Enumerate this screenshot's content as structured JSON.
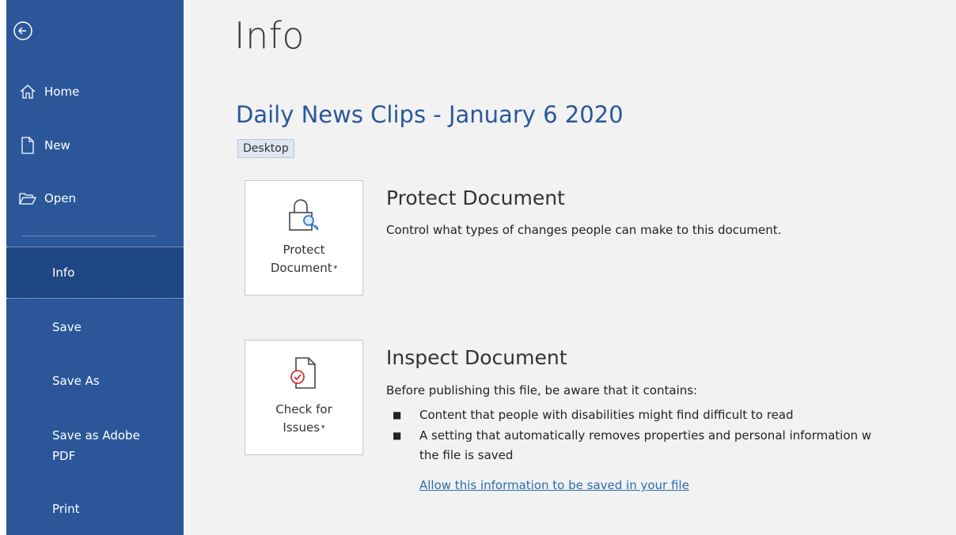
{
  "sidebar": {
    "items": [
      {
        "label": "Home",
        "icon": "home-icon"
      },
      {
        "label": "New",
        "icon": "new-document-icon"
      },
      {
        "label": "Open",
        "icon": "folder-open-icon"
      },
      {
        "label": "Info"
      },
      {
        "label": "Save"
      },
      {
        "label": "Save As"
      },
      {
        "label": "Save as Adobe PDF"
      },
      {
        "label": "Print"
      }
    ],
    "selected": "Info",
    "bg_color": "#2b579a",
    "selected_color": "#1e4784"
  },
  "main": {
    "title": "Info",
    "doc_name": "Daily News Clips - January 6 2020",
    "location": "Desktop",
    "protect": {
      "tile_label_line1": "Protect",
      "tile_label_line2": "Document",
      "title": "Protect Document",
      "desc": "Control what types of changes people can make to this document."
    },
    "inspect": {
      "tile_label_line1": "Check for",
      "tile_label_line2": "Issues",
      "title": "Inspect Document",
      "desc": "Before publishing this file, be aware that it contains:",
      "bullets": [
        "Content that people with disabilities might find difficult to read",
        "A setting that automatically removes properties and personal information w",
        "the file is saved"
      ],
      "link": "Allow this information to be saved in your file"
    }
  },
  "colors": {
    "accent": "#2b579a",
    "link": "#2b6cb0",
    "background": "#f2f2f2"
  }
}
